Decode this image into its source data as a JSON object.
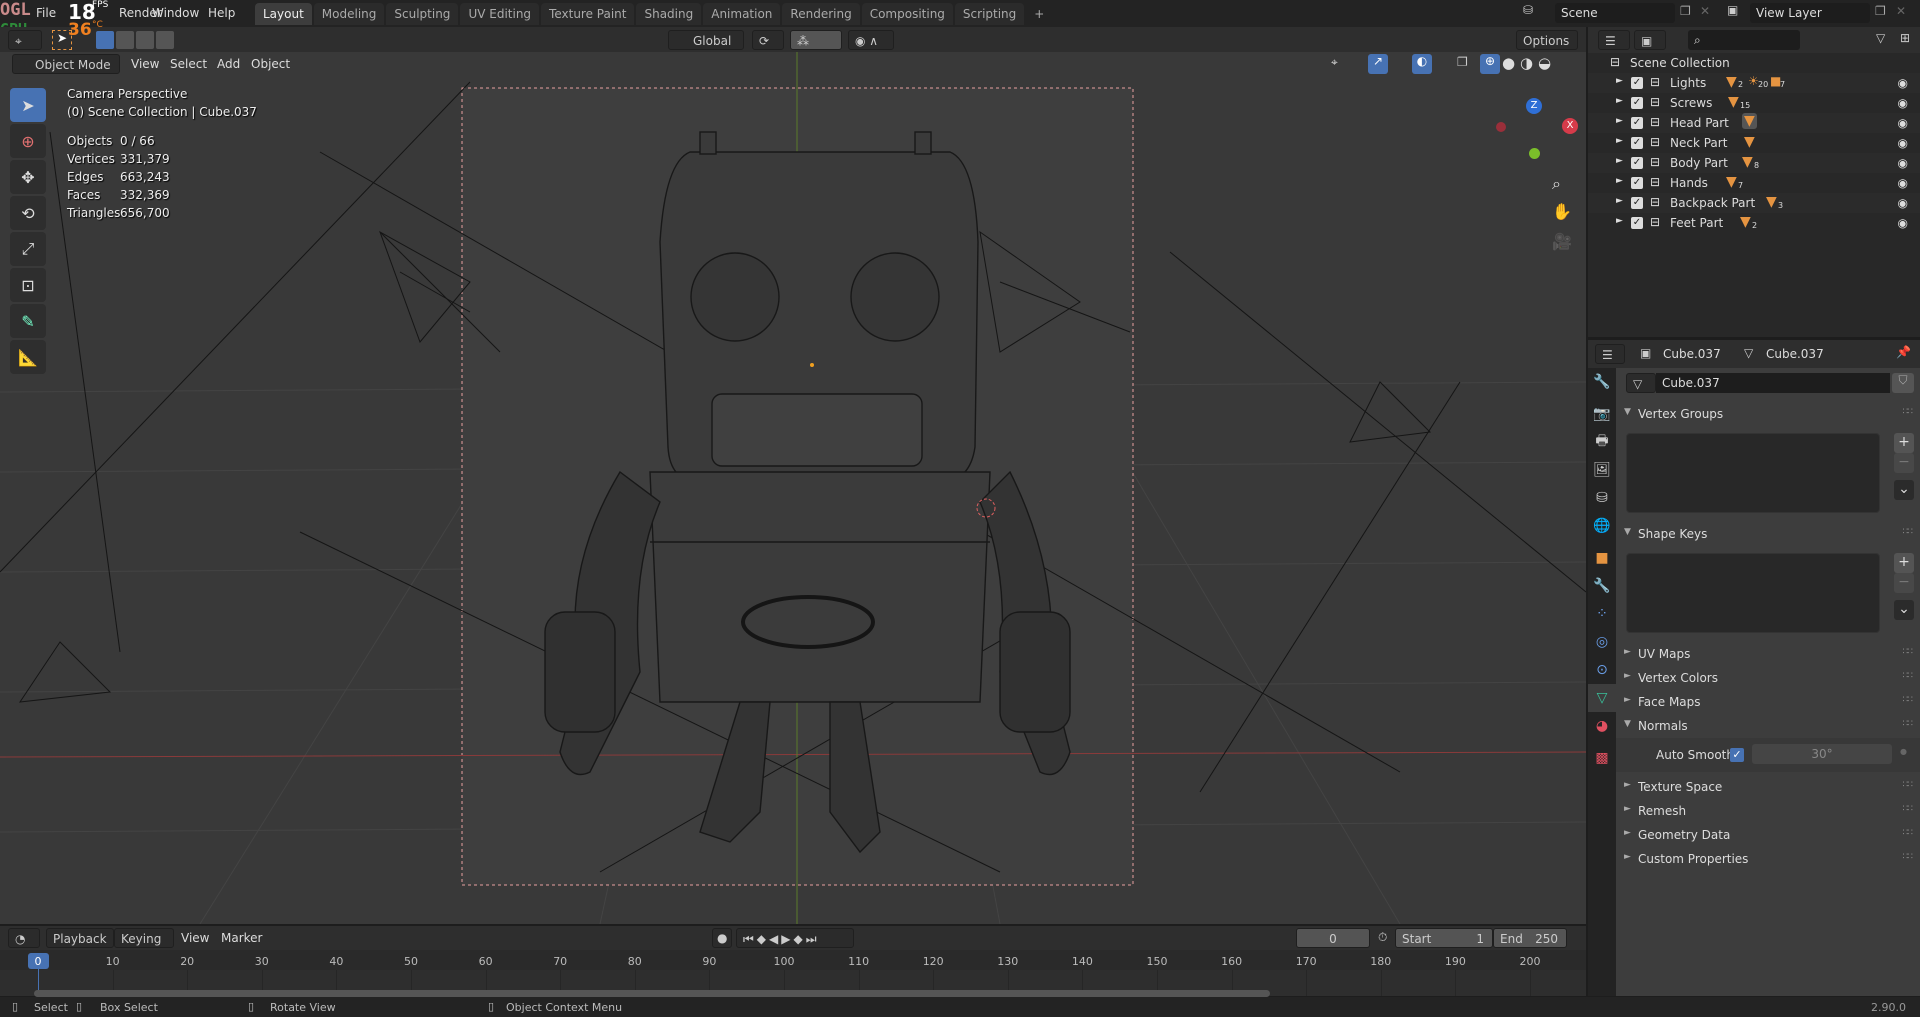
{
  "overlay_hud": {
    "ogl": "OGL",
    "gpu": "GPU",
    "fps_value": "18",
    "fps_label": "FPS",
    "temp_value": "36",
    "temp_unit": "°C"
  },
  "menu": [
    "File",
    "Render",
    "Window",
    "Help"
  ],
  "workspace_tabs": [
    "Layout",
    "Modeling",
    "Sculpting",
    "UV Editing",
    "Texture Paint",
    "Shading",
    "Animation",
    "Rendering",
    "Compositing",
    "Scripting"
  ],
  "add_tab": "+",
  "scene": {
    "name": "Scene",
    "view_layer": "View Layer"
  },
  "tool_header": {
    "orientation": "Global",
    "options": "Options"
  },
  "viewport_header": {
    "mode": "Object Mode",
    "menus": [
      "View",
      "Select",
      "Add",
      "Object"
    ]
  },
  "viewport_info": {
    "title": "Camera Perspective",
    "subtitle": "(0) Scene Collection | Cube.037",
    "stats": [
      {
        "label": "Objects",
        "value": "0 / 66"
      },
      {
        "label": "Vertices",
        "value": "331,379"
      },
      {
        "label": "Edges",
        "value": "663,243"
      },
      {
        "label": "Faces",
        "value": "332,369"
      },
      {
        "label": "Triangles",
        "value": "656,700"
      }
    ]
  },
  "gizmo": {
    "x": "X",
    "y": "Y",
    "z": "Z"
  },
  "outliner": {
    "root": "Scene Collection",
    "rows": [
      {
        "name": "Lights",
        "badges": "2",
        "extra": "20",
        "extra2": "7"
      },
      {
        "name": "Screws",
        "badges": "15"
      },
      {
        "name": "Head Part",
        "badges": ""
      },
      {
        "name": "Neck Part",
        "badges": ""
      },
      {
        "name": "Body Part",
        "badges": "8"
      },
      {
        "name": "Hands",
        "badges": "7"
      },
      {
        "name": "Backpack Part",
        "badges": "3"
      },
      {
        "name": "Feet Part",
        "badges": "2"
      }
    ]
  },
  "properties": {
    "object_name": "Cube.037",
    "mesh_name": "Cube.037",
    "datablock": "Cube.037",
    "panels": [
      "Vertex Groups",
      "Shape Keys",
      "UV Maps",
      "Vertex Colors",
      "Face Maps",
      "Normals",
      "Texture Space",
      "Remesh",
      "Geometry Data",
      "Custom Properties"
    ],
    "auto_smooth_label": "Auto Smooth",
    "auto_smooth_checked": true,
    "auto_smooth_angle": "30°"
  },
  "timeline": {
    "menus": [
      "Playback",
      "Keying",
      "View",
      "Marker"
    ],
    "current_frame": "0",
    "start_label": "Start",
    "start": "1",
    "end_label": "End",
    "end": "250",
    "ticks": [
      "0",
      "10",
      "20",
      "30",
      "40",
      "50",
      "60",
      "70",
      "80",
      "90",
      "100",
      "110",
      "120",
      "130",
      "140",
      "150",
      "160",
      "170",
      "180",
      "190",
      "200"
    ]
  },
  "statusbar": {
    "select": "Select",
    "box_select": "Box Select",
    "rotate_view": "Rotate View",
    "context_menu": "Object Context Menu",
    "version": "2.90.0"
  },
  "colors": {
    "accent": "#4772b3",
    "orange": "#e59441",
    "background": "#393939"
  }
}
